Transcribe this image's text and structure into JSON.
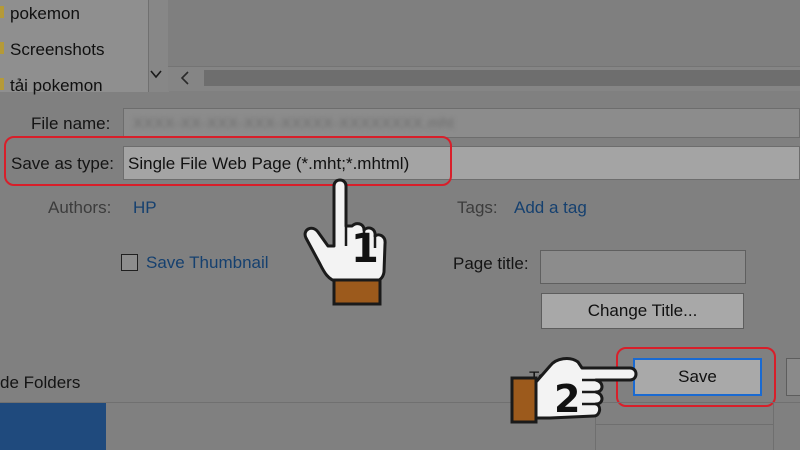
{
  "folder_tree": {
    "items": [
      {
        "label": "pokemon"
      },
      {
        "label": "Screenshots"
      },
      {
        "label": "tải pokemon"
      }
    ]
  },
  "form": {
    "file_name_label": "File name:",
    "file_name_value": "XXXX-XX-XXX-XXX-XXXXX-XXXXXXXX.mht",
    "save_as_type_label": "Save as type:",
    "save_as_type_value": "Single File Web Page (*.mht;*.mhtml)",
    "authors_label": "Authors:",
    "authors_value": "HP",
    "tags_label": "Tags:",
    "tags_value": "Add a tag",
    "save_thumbnail_label": "Save Thumbnail",
    "save_thumbnail_checked": false,
    "page_title_label": "Page title:",
    "page_title_value": "",
    "change_title_label": "Change Title...",
    "hide_folders_label": "de Folders",
    "tools_label_partial": "To",
    "save_label": "Save"
  },
  "annotations": {
    "step_1": "1",
    "step_2": "2",
    "highlight_color": "#d81f2a"
  },
  "icons": {
    "folder": "folder-icon",
    "chevron": "chevron-down-icon",
    "scroll_left": "chevron-left-icon",
    "hand_pointer": "hand-pointer-icon",
    "hand_pointing_right": "hand-pointing-right-icon"
  }
}
